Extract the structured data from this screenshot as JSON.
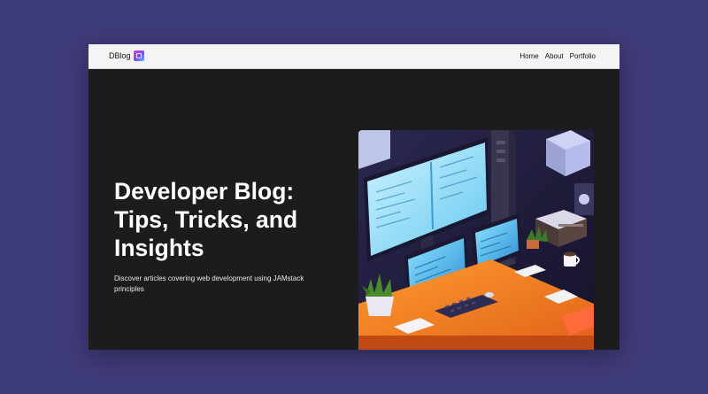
{
  "navbar": {
    "brand": "DBlog",
    "brand_logo_icon": "app-logo-icon",
    "links": [
      {
        "label": "Home"
      },
      {
        "label": "About"
      },
      {
        "label": "Portfolio"
      }
    ]
  },
  "hero": {
    "title": "Developer Blog: Tips, Tricks, and Insights",
    "subtitle": "Discover articles covering web development using JAMstack principles",
    "image_subject": "isometric developer desk illustration"
  },
  "colors": {
    "page_background": "#3f3c7a",
    "hero_background": "#1c1c1e",
    "navbar_background": "#f4f4f4",
    "title_text": "#ffffff"
  }
}
